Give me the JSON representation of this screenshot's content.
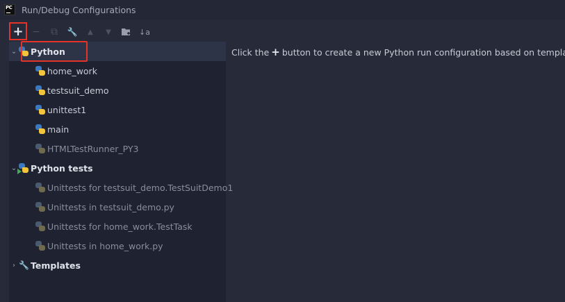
{
  "window": {
    "title": "Run/Debug Configurations"
  },
  "app_icon": {
    "text": "PC",
    "icon": "pycharm-icon"
  },
  "toolbar": {
    "add": "+",
    "remove": "−",
    "copy": "⧉",
    "edit": "🔧",
    "up": "▲",
    "down": "▼",
    "folder": "📁",
    "sort": "↓a"
  },
  "tree": {
    "python": {
      "label": "Python"
    },
    "python_items": [
      {
        "label": "home_work"
      },
      {
        "label": "testsuit_demo"
      },
      {
        "label": "unittest1"
      },
      {
        "label": "main"
      },
      {
        "label": "HTMLTestRunner_PY3"
      }
    ],
    "python_tests": {
      "label": "Python tests"
    },
    "python_tests_items": [
      {
        "label": "Unittests for testsuit_demo.TestSuitDemo1"
      },
      {
        "label": "Unittests in testsuit_demo.py"
      },
      {
        "label": "Unittests for home_work.TestTask"
      },
      {
        "label": "Unittests in home_work.py"
      }
    ],
    "templates": {
      "label": "Templates"
    }
  },
  "hint": {
    "prefix": "Click the",
    "plus": "+",
    "suffix": "button to create a new Python run configuration based on templates"
  },
  "colors": {
    "highlight": "#e5332a",
    "background": "#262a39",
    "panel": "#1f2231",
    "selected": "#2e3447"
  }
}
